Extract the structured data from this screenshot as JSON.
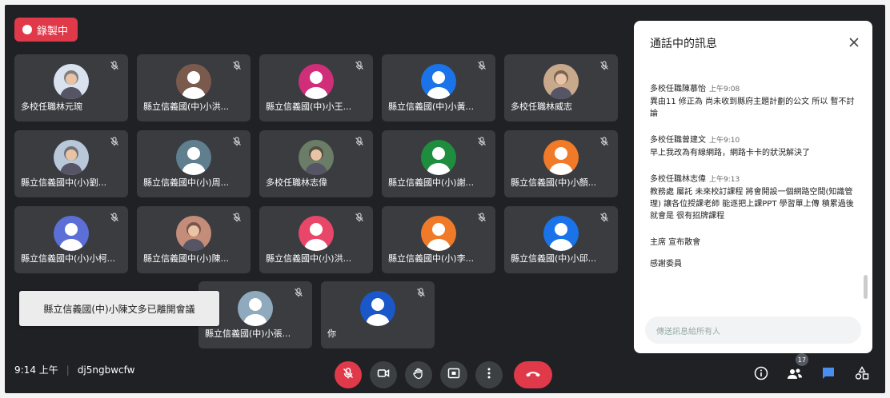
{
  "recording": {
    "label": "錄製中"
  },
  "tiles": [
    {
      "name": "多校任職林元琬",
      "avatar_color": "#d9e3ef",
      "photo": true
    },
    {
      "name": "縣立信義國(中)小洪...",
      "avatar_color": "#7b5a4e"
    },
    {
      "name": "縣立信義國(中)小王...",
      "avatar_color": "#d12e7a"
    },
    {
      "name": "縣立信義國(中)小黃...",
      "avatar_color": "#1a73e8"
    },
    {
      "name": "多校任職林威志",
      "avatar_color": "#c9a98c",
      "photo": true
    },
    {
      "name": "縣立信義國中(小)劉...",
      "avatar_color": "#b8c8d8",
      "photo": true
    },
    {
      "name": "縣立信義國中(小)周...",
      "avatar_color": "#5f7f8f"
    },
    {
      "name": "多校任職林志偉",
      "avatar_color": "#6b7d66",
      "photo": true
    },
    {
      "name": "縣立信義國中(小)謝...",
      "avatar_color": "#1e8e3e"
    },
    {
      "name": "縣立信義國(中)小顏...",
      "avatar_color": "#f07a28"
    },
    {
      "name": "縣立信義國中(小)小柯...",
      "avatar_color": "#5c6fd6"
    },
    {
      "name": "縣立信義國中(小)陳...",
      "avatar_color": "#c48d7a",
      "photo": true
    },
    {
      "name": "縣立信義國中(小)洪...",
      "avatar_color": "#e8476a"
    },
    {
      "name": "縣立信義國中(小)李...",
      "avatar_color": "#f07a28"
    },
    {
      "name": "縣立信義國(中)小邱...",
      "avatar_color": "#1a73e8"
    },
    {
      "name": "縣立信義國(中)小張...",
      "avatar_color": "#8fa9bd"
    },
    {
      "name": "你",
      "avatar_color": "#1a57c8"
    }
  ],
  "toast": {
    "text": "縣立信義國(中)小陳文多已離開會議"
  },
  "bottom": {
    "time": "9:14 上午",
    "meeting_code": "dj5ngbwcfw",
    "participant_count": "17"
  },
  "chat": {
    "title": "通話中的訊息",
    "messages": [
      {
        "sender": "多校任職陳慕怡",
        "time": "上午9:08",
        "text": "異由11 修正為 尚未收到縣府主題計劃的公文 所以 暫不討論"
      },
      {
        "sender": "多校任職曾建文",
        "time": "上午9:10",
        "text": "早上我改為有線網路，網路卡卡的狀況解決了"
      },
      {
        "sender": "多校任職林志偉",
        "time": "上午9:13",
        "text": "教務處 屬託 未來校訂課程 將會開設一個網路空間(知識管理) 讓各位授課老師 能逐把上課PPT 學習單上傳 積累過後 就會是 很有招牌課程"
      }
    ],
    "extra_lines": [
      "主席 宣布散會",
      "感謝委員"
    ],
    "input_placeholder": "傳送訊息給所有人"
  },
  "colors": {
    "background": "#1f2125",
    "tile": "#3a3c40",
    "danger": "#e0394a",
    "accent": "#1a73e8"
  }
}
